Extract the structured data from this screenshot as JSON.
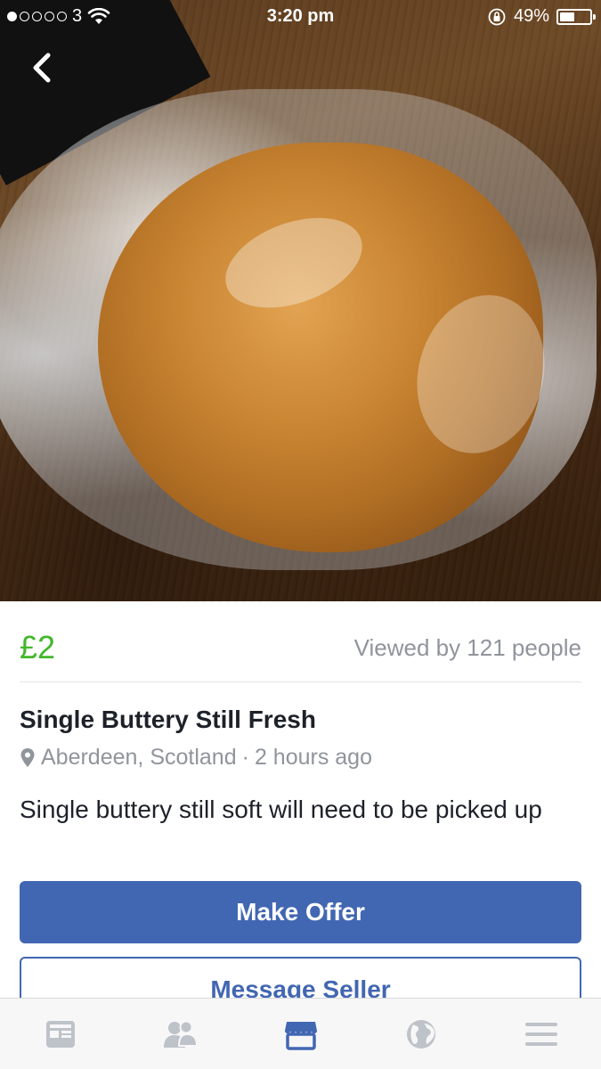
{
  "status_bar": {
    "carrier": "3",
    "signal_strength": 1,
    "time": "3:20 pm",
    "battery": "49%"
  },
  "listing": {
    "price": "£2",
    "views": "Viewed by 121 people",
    "title": "Single Buttery Still Fresh",
    "location": "Aberdeen, Scotland",
    "separator": "·",
    "posted": "2 hours ago",
    "description": "Single buttery still soft will need to be picked up"
  },
  "actions": {
    "make_offer": "Make Offer",
    "message_seller": "Message Seller"
  },
  "tabs": [
    {
      "icon": "news-feed-icon",
      "active": false
    },
    {
      "icon": "friends-icon",
      "active": false
    },
    {
      "icon": "marketplace-icon",
      "active": true
    },
    {
      "icon": "globe-icon",
      "active": false
    },
    {
      "icon": "menu-icon",
      "active": false
    }
  ],
  "colors": {
    "price": "#42b72a",
    "primary": "#4267b2",
    "muted": "#90949c",
    "tab_inactive": "#bec2c9"
  }
}
